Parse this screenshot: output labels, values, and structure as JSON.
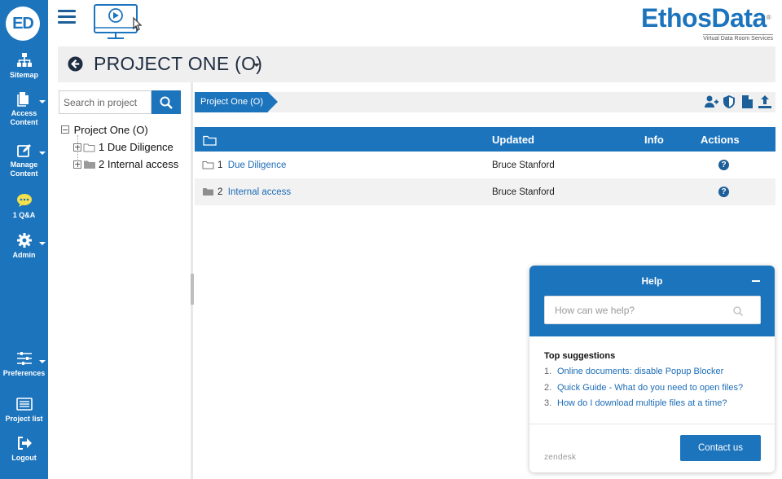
{
  "sidebar": {
    "logo": "ED",
    "items": [
      {
        "label": "Sitemap"
      },
      {
        "label_lines": [
          "Access",
          "Content"
        ]
      },
      {
        "label_lines": [
          "Manage",
          "Content"
        ]
      },
      {
        "label": "1 Q&A"
      },
      {
        "label": "Admin"
      },
      {
        "label": "Preferences"
      },
      {
        "label": "Project list"
      },
      {
        "label": "Logout"
      }
    ]
  },
  "brand": {
    "name": "EthosData",
    "reg": "®",
    "tagline": "Virtual Data Room Services"
  },
  "header": {
    "title": "PROJECT ONE (O)"
  },
  "tree": {
    "search_placeholder": "Search in project",
    "root": "Project One (O)",
    "children": [
      {
        "label": "1 Due Diligence"
      },
      {
        "label": "2 Internal access"
      }
    ]
  },
  "breadcrumb": {
    "current": "Project One (O)"
  },
  "table": {
    "headers": {
      "updated": "Updated",
      "info": "Info",
      "actions": "Actions"
    },
    "rows": [
      {
        "num": "1",
        "name": "Due Diligence",
        "updated": "Bruce Stanford",
        "action": "?"
      },
      {
        "num": "2",
        "name": "Internal access",
        "updated": "Bruce Stanford",
        "action": "?"
      }
    ]
  },
  "help": {
    "title": "Help",
    "search_placeholder": "How can we help?",
    "suggestions_title": "Top suggestions",
    "suggestions": [
      {
        "num": "1.",
        "text": "Online documents: disable Popup Blocker"
      },
      {
        "num": "2.",
        "text": "Quick Guide - What do you need to open files?"
      },
      {
        "num": "3.",
        "text": "How do I download multiple files at a time?"
      }
    ],
    "footer_brand": "zendesk",
    "contact_label": "Contact us"
  },
  "colors": {
    "primary": "#1c74bd",
    "dark_text": "#1e2c40",
    "link": "#1c6cb6"
  }
}
